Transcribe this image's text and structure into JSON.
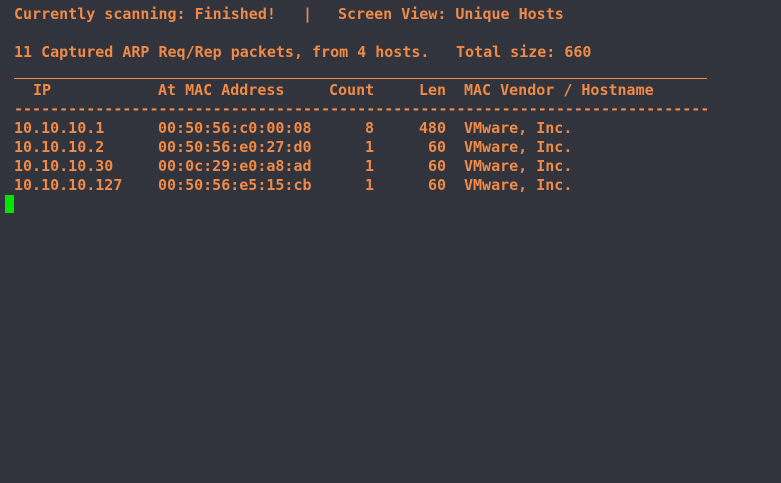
{
  "status": {
    "scanning_label": "Currently scanning: Finished!",
    "separator": "|",
    "view_label": "Screen View: Unique Hosts"
  },
  "summary": {
    "captured": "11 Captured ARP Req/Rep packets, from 4 hosts.",
    "total_size": "Total size: 660"
  },
  "table": {
    "headers": {
      "ip": "IP",
      "mac": "At MAC Address",
      "count": "Count",
      "len": "Len",
      "vendor": "MAC Vendor / Hostname"
    },
    "dashes": "-----------------------------------------------------------------------------",
    "rows": [
      {
        "ip": "10.10.10.1",
        "mac": "00:50:56:c0:00:08",
        "count": "8",
        "len": "480",
        "vendor": "VMware, Inc."
      },
      {
        "ip": "10.10.10.2",
        "mac": "00:50:56:e0:27:d0",
        "count": "1",
        "len": "60",
        "vendor": "VMware, Inc."
      },
      {
        "ip": "10.10.10.30",
        "mac": "00:0c:29:e0:a8:ad",
        "count": "1",
        "len": "60",
        "vendor": "VMware, Inc."
      },
      {
        "ip": "10.10.10.127",
        "mac": "00:50:56:e5:15:cb",
        "count": "1",
        "len": "60",
        "vendor": "VMware, Inc."
      }
    ]
  },
  "colors": {
    "background": "#31343c",
    "text": "#f08a48",
    "cursor": "#00e600"
  }
}
